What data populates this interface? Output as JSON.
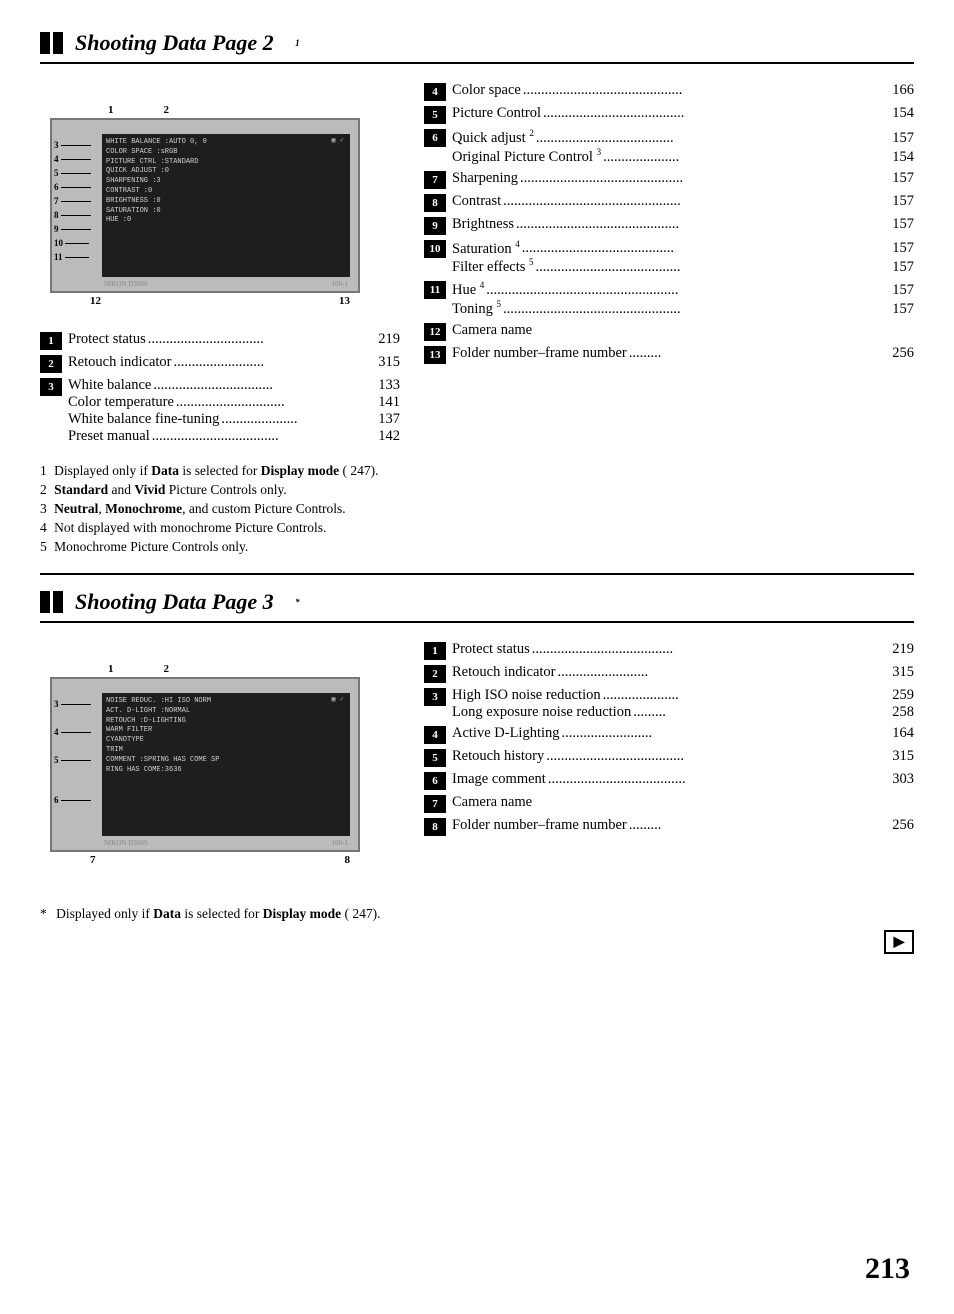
{
  "page1": {
    "title": "Shooting Data Page 2",
    "title_superscript": "1",
    "camera1": {
      "top_labels": [
        "1",
        "2"
      ],
      "left_labels": [
        {
          "num": "3",
          "top_pct": 22
        },
        {
          "num": "4",
          "top_pct": 30
        },
        {
          "num": "5",
          "top_pct": 38
        },
        {
          "num": "6",
          "top_pct": 46
        },
        {
          "num": "7",
          "top_pct": 53
        },
        {
          "num": "8",
          "top_pct": 60
        },
        {
          "num": "9",
          "top_pct": 67
        },
        {
          "num": "10",
          "top_pct": 74
        },
        {
          "num": "11",
          "top_pct": 81
        }
      ],
      "screen_lines": [
        "WHITE BALANCE :AUTO  0, 0",
        "COLOR SPACE   :sRGB",
        "PICTURE CTRL  :STANDARD",
        "QUICK ADJUST  :0",
        "SHARPENING    :3",
        "CONTRAST      :0",
        "BRIGHTNESS    :0",
        "SATURATION    :0",
        "HUE           :0"
      ],
      "bottom_labels": [
        "12",
        "13"
      ],
      "nikon_label": "NIKON D300S",
      "frame_label": "100-1"
    },
    "left_items": [
      {
        "num": "1",
        "entries": [
          {
            "text": "Protect status",
            "dots": true,
            "page": "219"
          }
        ]
      },
      {
        "num": "2",
        "entries": [
          {
            "text": "Retouch indicator",
            "dots": true,
            "page": "315"
          }
        ]
      },
      {
        "num": "3",
        "entries": [
          {
            "text": "White balance",
            "dots": true,
            "page": "133"
          },
          {
            "text": "Color temperature",
            "dots": true,
            "page": "141"
          },
          {
            "text": "White balance fine-tuning",
            "dots": true,
            "page": "137"
          },
          {
            "text": "Preset manual",
            "dots": true,
            "page": "142"
          }
        ]
      }
    ],
    "right_items": [
      {
        "num": "4",
        "entries": [
          {
            "text": "Color space",
            "dots": true,
            "page": "166"
          }
        ]
      },
      {
        "num": "5",
        "entries": [
          {
            "text": "Picture Control",
            "dots": true,
            "page": "154"
          }
        ]
      },
      {
        "num": "6",
        "entries": [
          {
            "text": "Quick adjust",
            "sup": "2",
            "dots": true,
            "page": "157"
          },
          {
            "text": "Original Picture Control",
            "sup": "3",
            "dots": true,
            "page": "154"
          }
        ]
      },
      {
        "num": "7",
        "entries": [
          {
            "text": "Sharpening",
            "dots": true,
            "page": "157"
          }
        ]
      },
      {
        "num": "8",
        "entries": [
          {
            "text": "Contrast",
            "dots": true,
            "page": "157"
          }
        ]
      },
      {
        "num": "9",
        "entries": [
          {
            "text": "Brightness",
            "dots": true,
            "page": "157"
          }
        ]
      },
      {
        "num": "10",
        "entries": [
          {
            "text": "Saturation",
            "sup": "4",
            "dots": true,
            "page": "157"
          },
          {
            "text": "Filter effects",
            "sup": "5",
            "dots": true,
            "page": "157"
          }
        ]
      },
      {
        "num": "11",
        "entries": [
          {
            "text": "Hue",
            "sup": "4",
            "dots": true,
            "page": "157"
          },
          {
            "text": "Toning",
            "sup": "5",
            "dots": true,
            "page": "157"
          }
        ]
      },
      {
        "num": "12",
        "entries": [
          {
            "text": "Camera name",
            "dots": false,
            "page": ""
          }
        ]
      },
      {
        "num": "13",
        "entries": [
          {
            "text": "Folder number–frame number",
            "dots": true,
            "page": "256"
          }
        ]
      }
    ],
    "footnotes": [
      "Displayed only if **Data** is selected for **Display mode** ( 247).",
      "**Standard** and **Vivid** Picture Controls only.",
      "**Neutral**, **Monochrome**, and custom Picture Controls.",
      "Not displayed with monochrome Picture Controls.",
      "Monochrome Picture Controls only."
    ]
  },
  "page2": {
    "title": "Shooting Data Page 3",
    "title_superscript": "*",
    "camera2": {
      "top_labels": [
        "1",
        "2"
      ],
      "left_labels": [
        {
          "num": "3",
          "top_pct": 28
        },
        {
          "num": "4",
          "top_pct": 42
        },
        {
          "num": "5",
          "top_pct": 56
        },
        {
          "num": "6",
          "top_pct": 70
        }
      ],
      "screen_lines": [
        "NOISE REDUC. :HI ISO NORM",
        "ACT. D-LIGHT :NORMAL",
        "RETOUCH      :D-LIGHTING",
        "             WARM FILTER",
        "             CYANOTYPE",
        "             TRIM",
        "COMMENT      :SPRING HAS COME SP",
        "             RING HAS COME:3636"
      ],
      "bottom_labels": [
        "7",
        "8"
      ],
      "nikon_label": "NIKON D300S",
      "frame_label": "100-1"
    },
    "left_items": [
      {
        "num": "1",
        "entries": [
          {
            "text": "Protect status",
            "dots": true,
            "page": "219"
          }
        ]
      },
      {
        "num": "2",
        "entries": [
          {
            "text": "Retouch indicator",
            "dots": true,
            "page": "315"
          }
        ]
      },
      {
        "num": "3",
        "entries": [
          {
            "text": "High ISO noise reduction",
            "dots": true,
            "page": "259"
          },
          {
            "text": "Long exposure noise reduction",
            "dots": true,
            "page": "258"
          }
        ]
      },
      {
        "num": "4",
        "entries": [
          {
            "text": "Active D-Lighting",
            "dots": true,
            "page": "164"
          }
        ]
      },
      {
        "num": "5",
        "entries": [
          {
            "text": "Retouch history",
            "dots": true,
            "page": "315"
          }
        ]
      },
      {
        "num": "6",
        "entries": [
          {
            "text": "Image comment",
            "dots": true,
            "page": "303"
          }
        ]
      },
      {
        "num": "7",
        "entries": [
          {
            "text": "Camera name",
            "dots": false,
            "page": ""
          }
        ]
      },
      {
        "num": "8",
        "entries": [
          {
            "text": "Folder number–frame number",
            "dots": true,
            "page": "256"
          }
        ]
      }
    ],
    "footnote": "Displayed only if **Data** is selected for **Display mode** ( 247).",
    "footnote_star": "*"
  },
  "page_number": "213"
}
